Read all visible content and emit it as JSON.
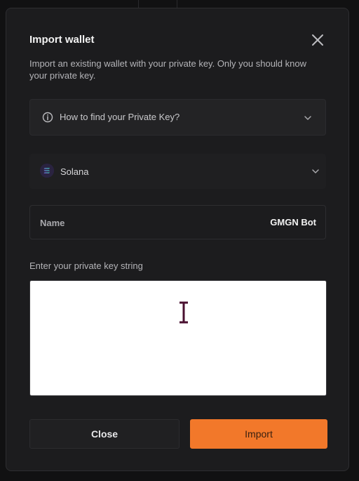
{
  "modal": {
    "title": "Import wallet",
    "description": "Import an existing wallet with your private key. Only you should know your private key."
  },
  "accordion": {
    "label": "How to find your Private Key?"
  },
  "chain": {
    "selected": "Solana"
  },
  "name_field": {
    "label": "Name",
    "value": "GMGN Bot"
  },
  "private_key": {
    "label": "Enter your private key string",
    "value": ""
  },
  "actions": {
    "close_label": "Close",
    "import_label": "Import"
  },
  "colors": {
    "accent": "#f2782a",
    "modal_bg": "#1c1c1e",
    "input_bg": "#ffffff"
  },
  "icons": [
    "close-icon",
    "info-icon",
    "chevron-down-icon",
    "solana-logo-icon",
    "text-cursor-icon"
  ]
}
